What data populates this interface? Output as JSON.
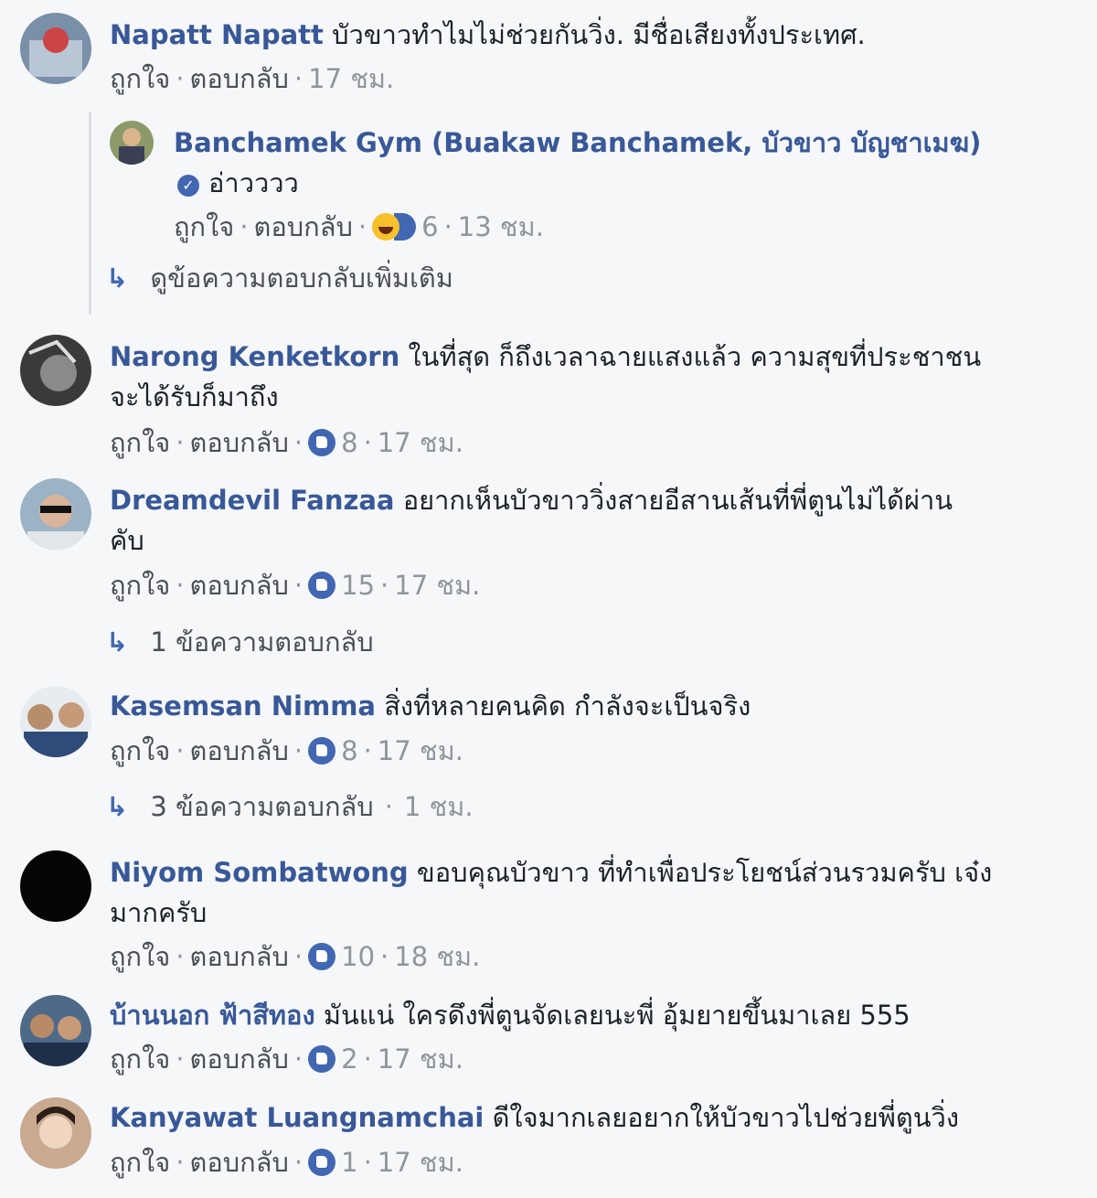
{
  "actions": {
    "like": "ถูกใจ",
    "reply": "ตอบกลับ",
    "sep": "·"
  },
  "comments": [
    {
      "name": "Napatt Napatt",
      "text": "บัวขาวทำไมไม่ช่วยกันวิ่ง. มีชื่อเสียงทั้งประเทศ.",
      "time": "17 ชม.",
      "avatar_color": "#7a8fa8"
    },
    {
      "name": "Narong Kenketkorn",
      "text": "ในที่สุด ก็ถึงเวลาฉายแสงแล้ว ความสุขที่ประชาชน",
      "text2": "จะได้รับก็มาถึง",
      "reactions": "8",
      "time": "17 ชม.",
      "avatar_color": "#3a3a3a"
    },
    {
      "name": "Dreamdevil Fanzaa",
      "text": "อยากเห็นบัวขาววิ่งสายอีสานเส้นที่พี่ตูนไม่ได้ผ่าน",
      "text2": "คับ",
      "reactions": "15",
      "time": "17 ชม.",
      "reply_summary": "1 ข้อความตอบกลับ",
      "avatar_color": "#9bb3c4"
    },
    {
      "name": "Kasemsan Nimma",
      "text": "สิ่งที่หลายคนคิด กำลังจะเป็นจริง",
      "reactions": "8",
      "time": "17 ชม.",
      "reply_summary": "3 ข้อความตอบกลับ",
      "reply_time": "1 ชม.",
      "avatar_color": "#5a6e8c"
    },
    {
      "name": "Niyom Sombatwong",
      "text": "ขอบคุณบัวขาว ที่ทำเพื่อประโยชน์ส่วนรวมครับ เจ๋ง",
      "text2": "มากครับ",
      "reactions": "10",
      "time": "18 ชม.",
      "avatar_color": "#050505"
    },
    {
      "name": "บ้านนอก ฟ้าสีทอง",
      "text": "มันแน่ ใครดึงพี่ตูนจัดเลยนะพี่ อุ้มยายขึ้นมาเลย 555",
      "reactions": "2",
      "time": "17 ชม.",
      "avatar_color": "#4f6a88"
    },
    {
      "name": "Kanyawat Luangnamchai",
      "text": "ดีใจมากเลยอยากให้บัวขาวไปช่วยพี่ตูนวิ่ง",
      "reactions": "1",
      "time": "17 ชม.",
      "avatar_color": "#c9a98f"
    }
  ],
  "reply": {
    "name": "Banchamek Gym (Buakaw Banchamek, บัวขาว บัญชาเมฆ)",
    "text": "อ่าวววว",
    "reactions": "6",
    "time": "13 ชม.",
    "more_replies": "ดูข้อความตอบกลับเพิ่มเติม",
    "avatar_color": "#8c9a6a"
  }
}
